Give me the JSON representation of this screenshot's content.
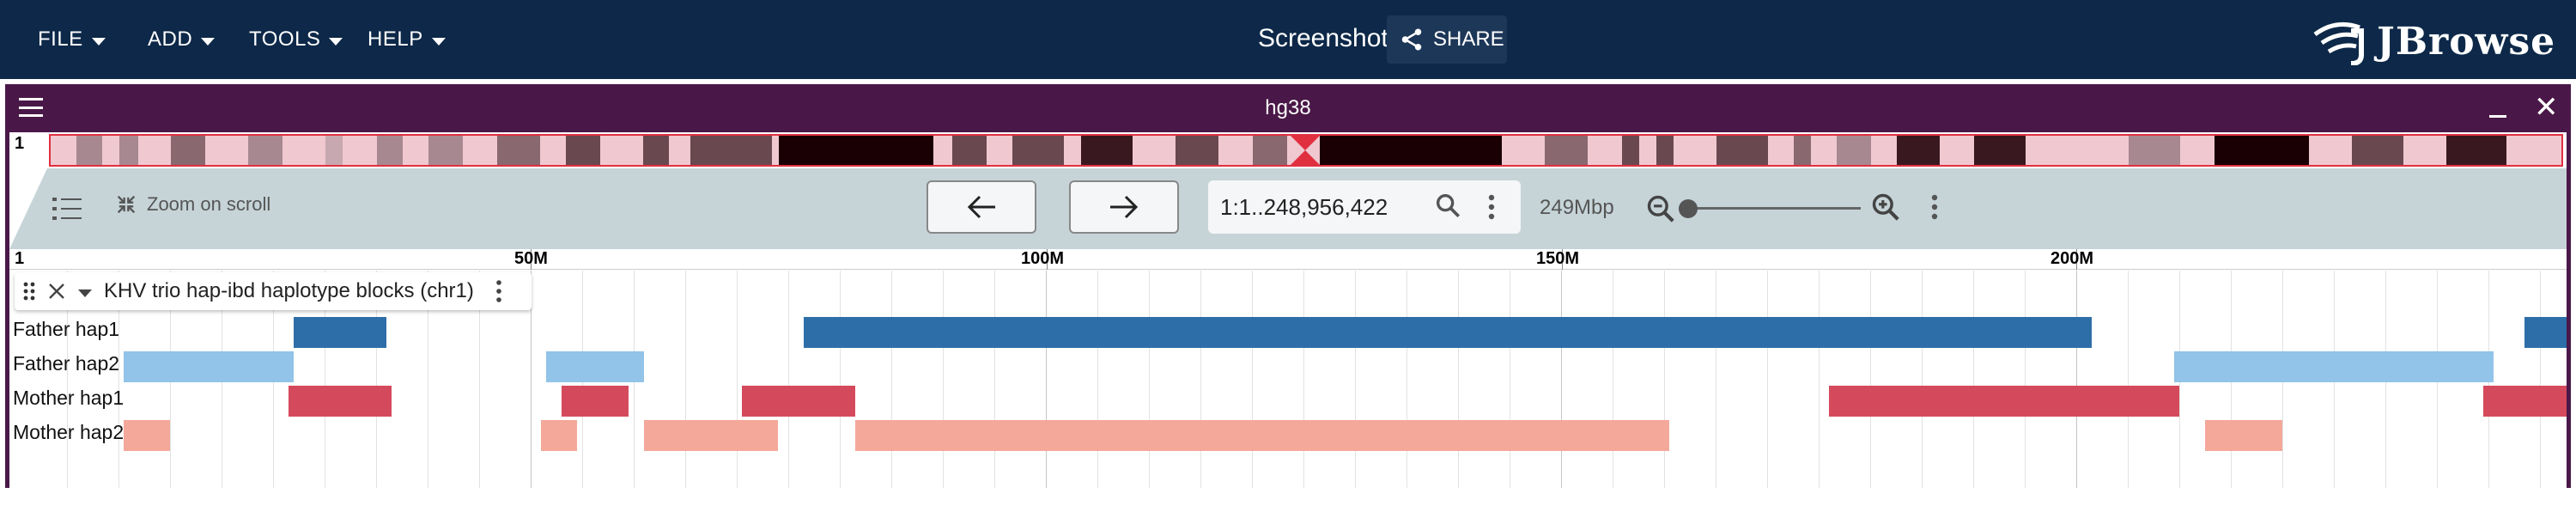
{
  "menus": [
    {
      "label": "FILE"
    },
    {
      "label": "ADD"
    },
    {
      "label": "TOOLS"
    },
    {
      "label": "HELP"
    }
  ],
  "session": {
    "title": "Screenshot",
    "share_label": "SHARE"
  },
  "logo": {
    "text": "JBrowse"
  },
  "view": {
    "title": "hg38",
    "overview_label": "1",
    "zoom_on_scroll": "Zoom on scroll",
    "location": "1:1..248,956,422",
    "bp_per_px": "249Mbp"
  },
  "ruler": {
    "start_label": "1",
    "ticks": [
      {
        "label": "50M"
      },
      {
        "label": "100M"
      },
      {
        "label": "150M"
      },
      {
        "label": "200M"
      }
    ]
  },
  "track": {
    "name": "KHV trio hap-ibd haplotype blocks (chr1)",
    "rows": [
      {
        "label": "Father hap1",
        "color": "#2e6ea8",
        "blocks": [
          [
            27,
            36
          ],
          [
            76.5,
            201.5
          ],
          [
            243.5,
            254
          ]
        ]
      },
      {
        "label": "Father hap2",
        "color": "#92c3e8",
        "blocks": [
          [
            10.5,
            27
          ],
          [
            51.5,
            61
          ],
          [
            209.5,
            240.5
          ]
        ]
      },
      {
        "label": "Mother hap1",
        "color": "#d44a5c",
        "blocks": [
          [
            26.5,
            36.5
          ],
          [
            53,
            59.5
          ],
          [
            70.5,
            81.5
          ],
          [
            176,
            210
          ],
          [
            239.5,
            253
          ]
        ]
      },
      {
        "label": "Mother hap2",
        "color": "#f4a89a",
        "blocks": [
          [
            10.5,
            15
          ],
          [
            51,
            54.5
          ],
          [
            61,
            74
          ],
          [
            81.5,
            160.5
          ],
          [
            212.5,
            220
          ]
        ]
      }
    ]
  },
  "chart_data": {
    "type": "table",
    "x_unit": "Mbp",
    "xlim": [
      0,
      255
    ]
  },
  "colors": {
    "topbar": "#0d2848",
    "view_header": "#4a1848",
    "controls_bg": "#c6d4d8"
  }
}
